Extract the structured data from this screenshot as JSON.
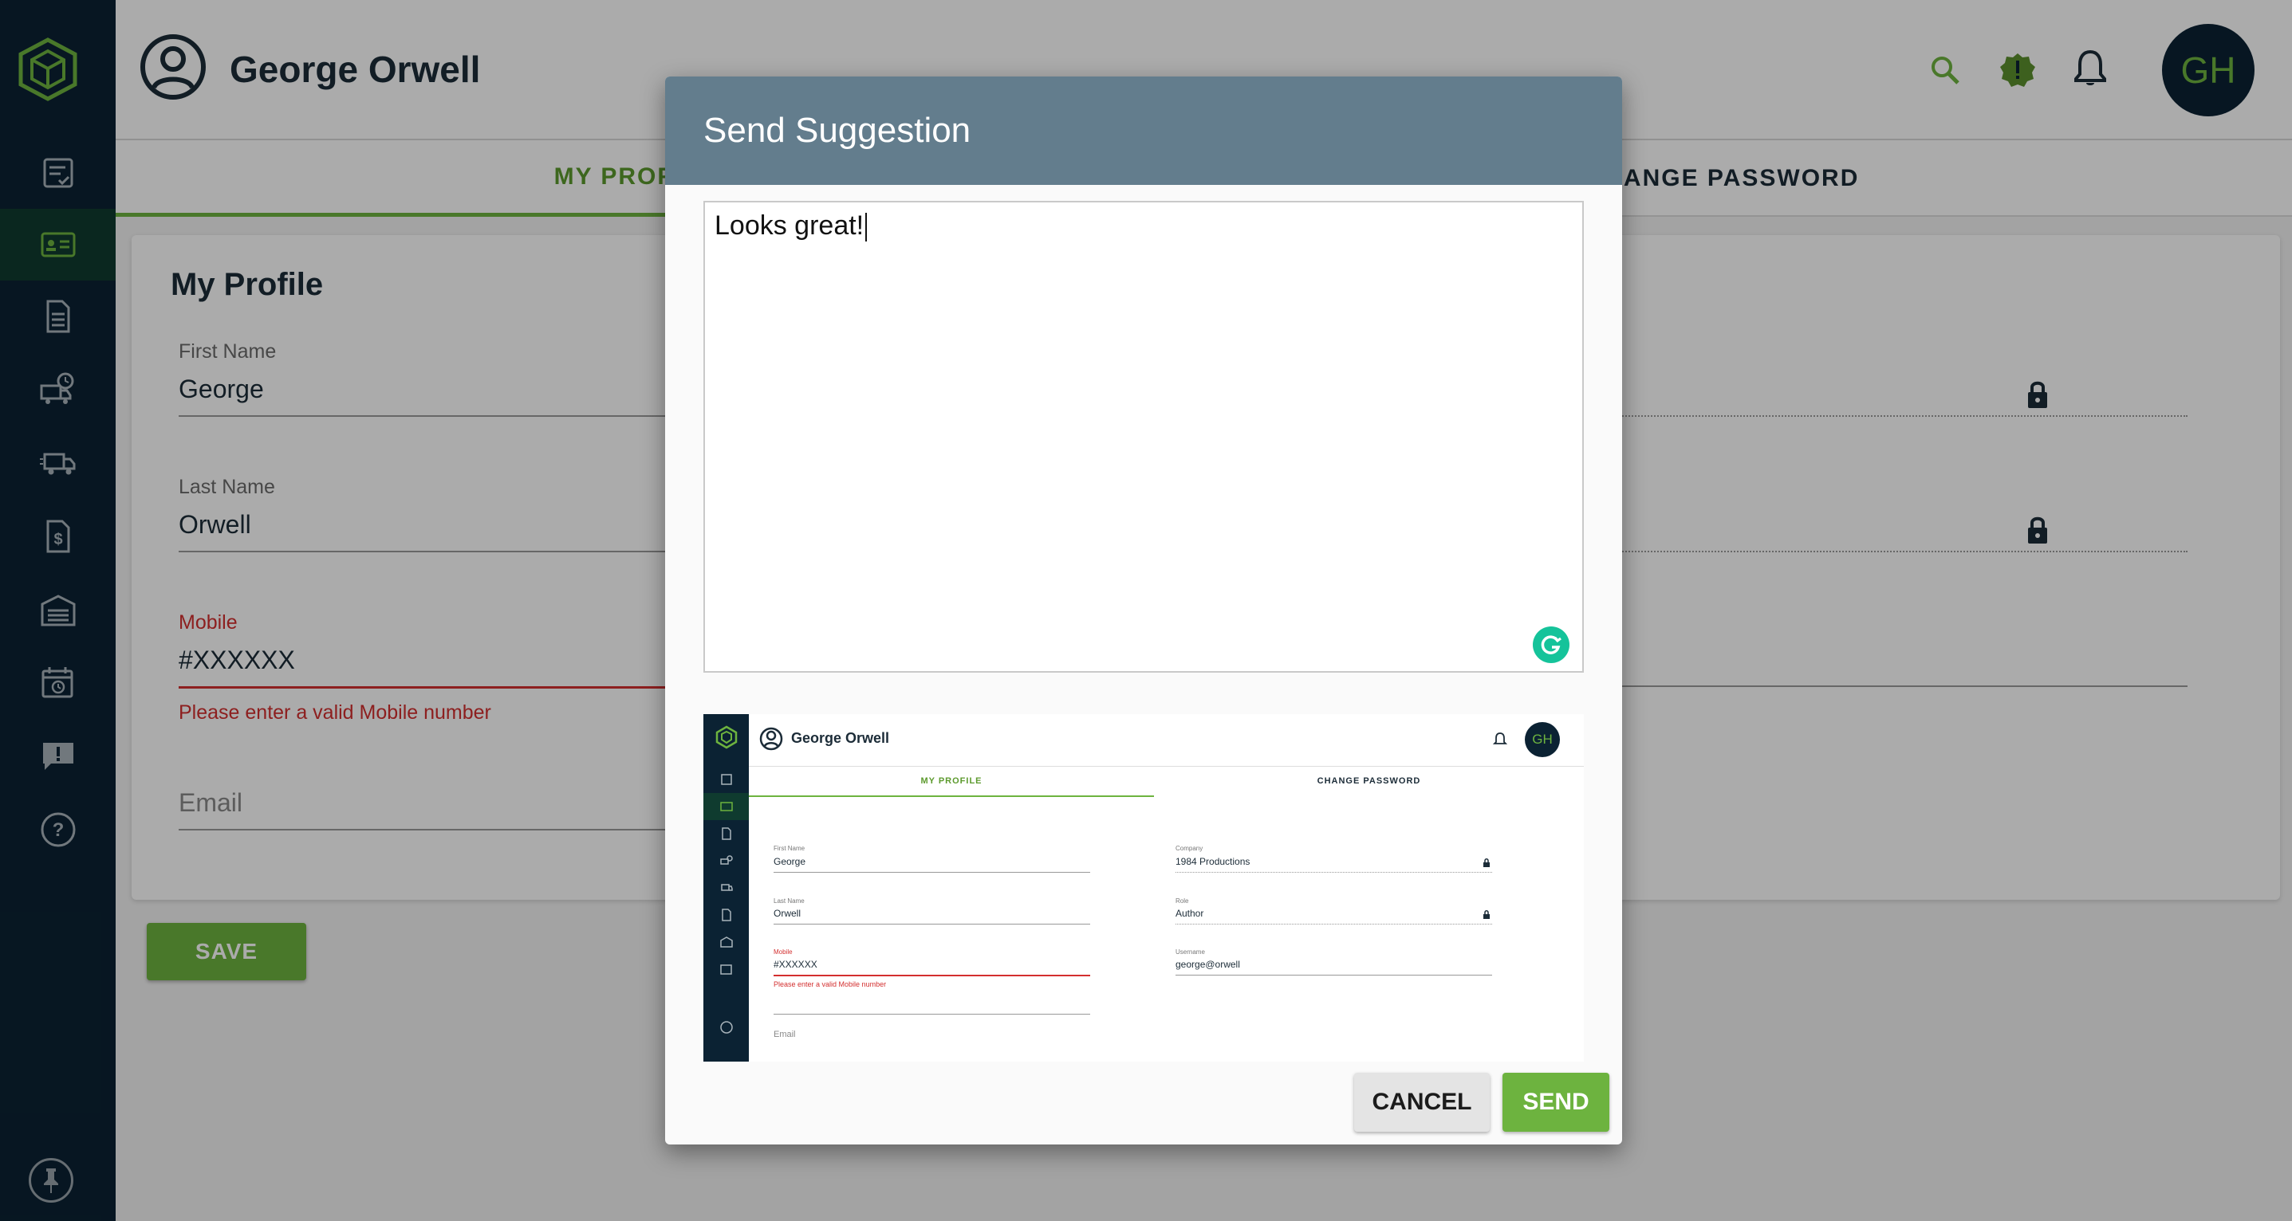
{
  "header": {
    "user_name": "George Orwell",
    "avatar_initials": "GH",
    "icons": [
      "search-icon",
      "alert-badge-icon",
      "bell-icon"
    ]
  },
  "tabs": [
    {
      "label": "MY PROFILE",
      "active": true
    },
    {
      "label": "CHANGE PASSWORD",
      "active": false
    }
  ],
  "profile": {
    "title": "My Profile",
    "first_name_label": "First Name",
    "first_name": "George",
    "last_name_label": "Last Name",
    "last_name": "Orwell",
    "mobile_label": "Mobile",
    "mobile": "#XXXXXX",
    "mobile_error": "Please enter a valid Mobile number",
    "email_label": "Email",
    "save_label": "SAVE"
  },
  "sidebar": {
    "items": [
      "logo-icon",
      "orders-icon",
      "profile-card-icon",
      "document-icon",
      "shipment-clock-icon",
      "truck-icon",
      "invoice-dollar-icon",
      "warehouse-icon",
      "calendar-clock-icon",
      "feedback-icon",
      "help-icon",
      "pin-icon"
    ],
    "active_index": 1
  },
  "modal": {
    "title": "Send Suggestion",
    "message": "Looks great!",
    "cancel_label": "CANCEL",
    "send_label": "SEND"
  },
  "preview": {
    "user_name": "George Orwell",
    "avatar_initials": "GH",
    "tab_profile": "MY PROFILE",
    "tab_password": "CHANGE PASSWORD",
    "first_name_label": "First Name",
    "first_name": "George",
    "last_name_label": "Last Name",
    "last_name": "Orwell",
    "mobile_label": "Mobile",
    "mobile": "#XXXXXX",
    "mobile_error": "Please enter a valid Mobile number",
    "email_label": "Email",
    "company_label": "Company",
    "company": "1984 Productions",
    "role_label": "Role",
    "role": "Author",
    "username_label": "Username",
    "username": "george@orwell"
  },
  "colors": {
    "sidebar": "#0b2233",
    "accent": "#6db33f",
    "modal_header": "#637d8d",
    "error": "#d32f2f"
  }
}
